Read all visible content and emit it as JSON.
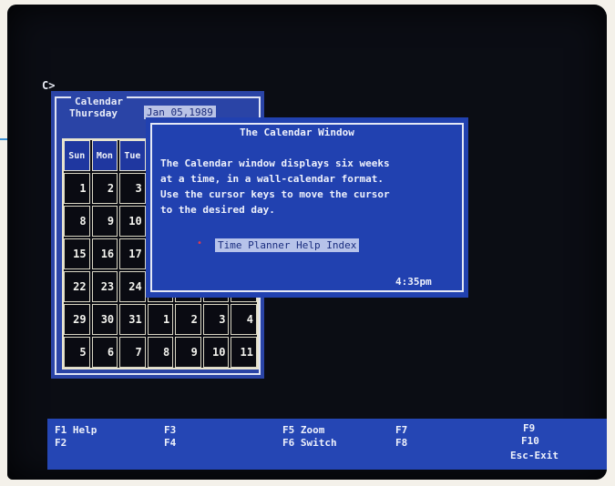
{
  "prompt": "C>",
  "calendar": {
    "title": "Calendar",
    "day_name": "Thursday",
    "date": "Jan 05,1989",
    "weekdays": [
      "Sun",
      "Mon",
      "Tue",
      "",
      "",
      "",
      ""
    ],
    "weeks": [
      [
        "1",
        "2",
        "3",
        "",
        "",
        "",
        ""
      ],
      [
        "8",
        "9",
        "10",
        "",
        "",
        "",
        ""
      ],
      [
        "15",
        "16",
        "17",
        "",
        "",
        "",
        ""
      ],
      [
        "22",
        "23",
        "24",
        "",
        "",
        "",
        ""
      ],
      [
        "29",
        "30",
        "31",
        "1",
        "2",
        "3",
        "4"
      ],
      [
        "5",
        "6",
        "7",
        "8",
        "9",
        "10",
        "11"
      ]
    ]
  },
  "help": {
    "title": "The Calendar Window",
    "lines": [
      "The Calendar window displays six weeks",
      "at a time, in a wall-calendar format.",
      "Use the cursor keys to move the cursor",
      "to the desired day."
    ],
    "link": "Time Planner Help Index",
    "clock": "4:35pm"
  },
  "fkeys": {
    "f1": "F1 Help",
    "f2": "F2",
    "f3": "F3",
    "f4": "F4",
    "f5": "F5 Zoom",
    "f6": "F6 Switch",
    "f7": "F7",
    "f8": "F8",
    "f9": "F9",
    "f10": "F10",
    "esc": "Esc-Exit"
  },
  "colors": {
    "window_blue": "#2141b0",
    "screen_black": "#0b0d14",
    "grid_line": "#e8e4cf",
    "highlight": "#b7c3ea",
    "bullet_red": "#e23a4c"
  }
}
